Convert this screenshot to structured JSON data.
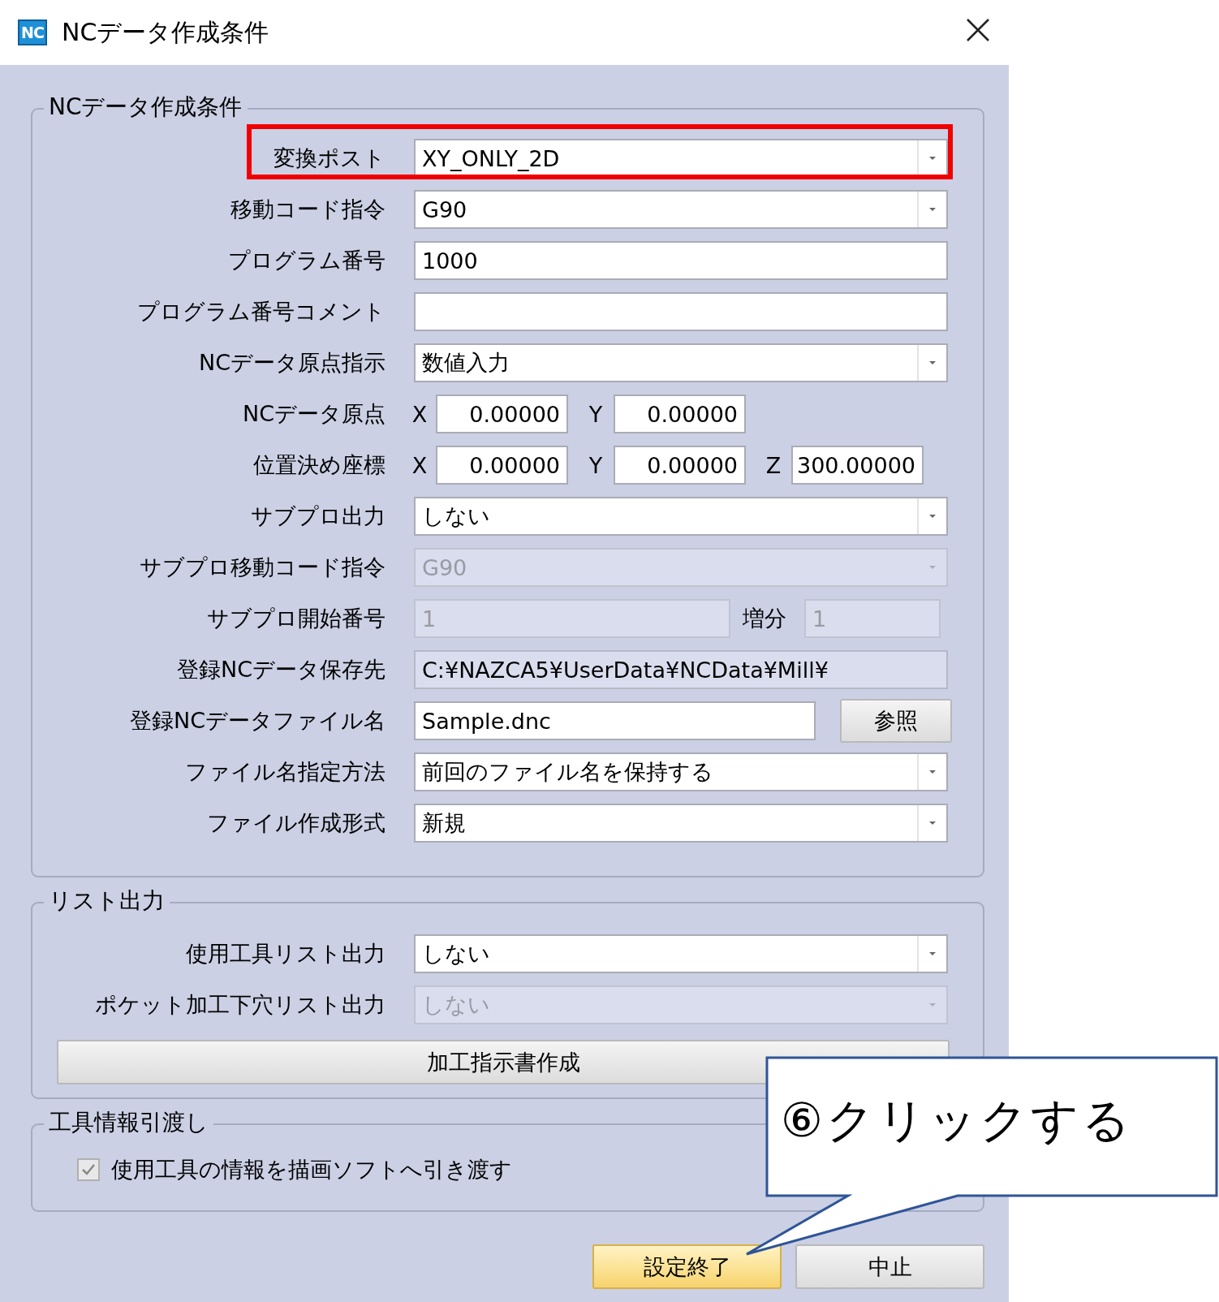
{
  "window": {
    "icon_text": "NC",
    "title": "NCデータ作成条件"
  },
  "groups": [
    {
      "title": "NCデータ作成条件",
      "rows": [
        {
          "kind": "select",
          "label": "変換ポスト",
          "value": "XY_ONLY_2D",
          "disabled": false,
          "highlighted": true
        },
        {
          "kind": "select",
          "label": "移動コード指令",
          "value": "G90",
          "disabled": false
        },
        {
          "kind": "text",
          "label": "プログラム番号",
          "value": "1000",
          "disabled": false
        },
        {
          "kind": "text",
          "label": "プログラム番号コメント",
          "disabled": false
        },
        {
          "kind": "select",
          "label": "NCデータ原点指示",
          "value": "数値入力",
          "disabled": false
        },
        {
          "kind": "coords",
          "label": "NCデータ原点",
          "fields": [
            {
              "axis": "X",
              "value": "0.00000"
            },
            {
              "axis": "Y",
              "value": "0.00000"
            }
          ]
        },
        {
          "kind": "coords",
          "label": "位置決め座標",
          "fields": [
            {
              "axis": "X",
              "value": "0.00000"
            },
            {
              "axis": "Y",
              "value": "0.00000"
            },
            {
              "axis": "Z",
              "value": "300.00000"
            }
          ]
        },
        {
          "kind": "select",
          "label": "サブプロ出力",
          "value": "しない",
          "disabled": false
        },
        {
          "kind": "select",
          "label": "サブプロ移動コード指令",
          "value": "G90",
          "disabled": true
        },
        {
          "kind": "pair",
          "label": "サブプロ開始番号",
          "value": "1",
          "extra_label": "増分",
          "extra_value": "1",
          "disabled": true
        },
        {
          "kind": "text",
          "label": "登録NCデータ保存先",
          "value": "C:¥NAZCA5¥UserData¥NCData¥Mill¥",
          "disabled": false,
          "readonly": true
        },
        {
          "kind": "file",
          "label": "登録NCデータファイル名",
          "value": "Sample.dnc",
          "button": "参照"
        },
        {
          "kind": "select",
          "label": "ファイル名指定方法",
          "value": "前回のファイル名を保持する",
          "disabled": false
        },
        {
          "kind": "select",
          "label": "ファイル作成形式",
          "value": "新規",
          "disabled": false
        }
      ]
    },
    {
      "title": "リスト出力",
      "rows": [
        {
          "kind": "select",
          "label": "使用工具リスト出力",
          "value": "しない",
          "disabled": false
        },
        {
          "kind": "select",
          "label": "ポケット加工下穴リスト出力",
          "value": "しない",
          "disabled": true
        },
        {
          "kind": "action",
          "label": "加工指示書作成"
        }
      ]
    },
    {
      "title": "工具情報引渡し",
      "rows": [
        {
          "kind": "checkbox",
          "label": "使用工具の情報を描画ソフトへ引き渡す",
          "checked": true
        }
      ]
    }
  ],
  "buttons": [
    {
      "label": "設定終了",
      "highlighted": true
    },
    {
      "label": "中止",
      "highlighted": false
    }
  ],
  "callout": {
    "text": "⑥クリックする"
  }
}
